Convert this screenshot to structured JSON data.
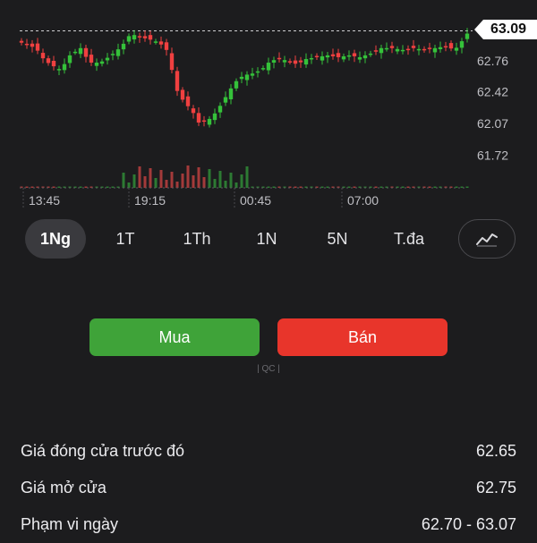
{
  "chart": {
    "current_price": "63.09",
    "price_ticks": [
      "62.76",
      "62.42",
      "62.07",
      "61.72"
    ],
    "time_ticks": [
      "13:45",
      "19:15",
      "00:45",
      "07:00"
    ],
    "colors": {
      "up": "#35c23a",
      "down": "#f04040"
    }
  },
  "timeframes": {
    "items": [
      {
        "label": "1Ng",
        "active": true
      },
      {
        "label": "1T",
        "active": false
      },
      {
        "label": "1Th",
        "active": false
      },
      {
        "label": "1N",
        "active": false
      },
      {
        "label": "5N",
        "active": false
      },
      {
        "label": "T.đa",
        "active": false
      }
    ],
    "chart_type_icon": "line-chart-icon"
  },
  "actions": {
    "buy_label": "Mua",
    "sell_label": "Bán",
    "ad_label": "| QC |"
  },
  "stats": [
    {
      "label": "Giá đóng cửa trước đó",
      "value": "62.65"
    },
    {
      "label": "Giá mở cửa",
      "value": "62.75"
    },
    {
      "label": "Phạm vi ngày",
      "value": "62.70 - 63.07"
    }
  ]
}
